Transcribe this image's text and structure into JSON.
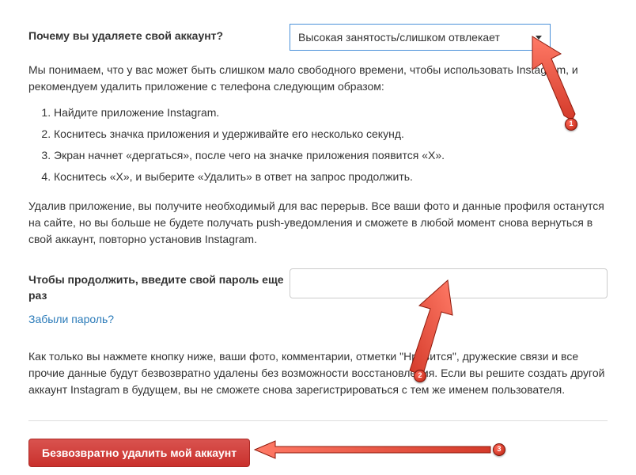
{
  "question": {
    "label": "Почему вы удаляете свой аккаунт?",
    "selected": "Высокая занятость/слишком отвлекает"
  },
  "intro": "Мы понимаем, что у вас может быть слишком мало свободного времени, чтобы использовать Instagram, и рекомендуем удалить приложение с телефона следующим образом:",
  "steps": [
    "Найдите приложение Instagram.",
    "Коснитесь значка приложения и удерживайте его несколько секунд.",
    "Экран начнет «дергаться», после чего на значке приложения появится «X».",
    "Коснитесь «X», и выберите «Удалить» в ответ на запрос продолжить."
  ],
  "after_uninstall": "Удалив приложение, вы получите необходимый для вас перерыв. Все ваши фото и данные профиля останутся на сайте, но вы больше не будете получать push-уведомления и сможете в любой момент снова вернуться в свой аккаунт, повторно установив Instagram.",
  "password": {
    "label": "Чтобы продолжить, введите свой пароль еще раз",
    "value": ""
  },
  "forgot": "Забыли пароль?",
  "warning": "Как только вы нажмете кнопку ниже, ваши фото, комментарии, отметки \"Нравится\", дружеские связи и все прочие данные будут безвозвратно удалены без возможности восстановления. Если вы решите создать другой аккаунт Instagram в будущем, вы не сможете снова зарегистрироваться с тем же именем пользователя.",
  "delete_btn": "Безвозвратно удалить мой аккаунт",
  "markers": {
    "m1": "1",
    "m2": "2",
    "m3": "3"
  }
}
